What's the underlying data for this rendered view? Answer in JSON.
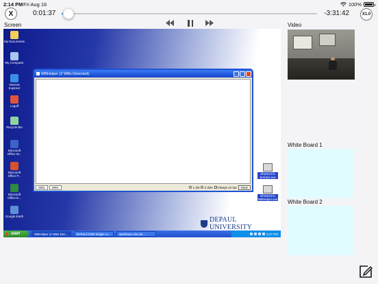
{
  "status_bar": {
    "time": "2:14 PM",
    "date": "Fri Aug 16",
    "battery": "100%",
    "battery_level": 1.0
  },
  "player": {
    "close_label": "X",
    "elapsed": "0:01:37",
    "remaining": "-3:31:42",
    "speed_label": "X1.0",
    "progress": 0.0045,
    "accent_color": "#0a7aff"
  },
  "controls": {
    "rewind_icon": "rewind-icon",
    "pause_icon": "pause-icon",
    "forward_icon": "fast-forward-icon"
  },
  "labels": {
    "screen": "Screen",
    "video": "Video",
    "white_board_1": "White Board 1",
    "white_board_2": "White Board 2"
  },
  "desktop": {
    "icons": [
      {
        "label": "My Documents",
        "color": "#f3cf5a"
      },
      {
        "label": "My Computer",
        "color": "#a9c7ee"
      },
      {
        "label": "Internet Explorer",
        "color": "#3b8ee8"
      },
      {
        "label": "Logoff",
        "color": "#e0543a"
      },
      {
        "label": "Recycle Bin",
        "color": "#8fd3a0"
      },
      {
        "label": "Microsoft Office W...",
        "color": "#3c62c8"
      },
      {
        "label": "Microsoft Office P...",
        "color": "#d8532d"
      },
      {
        "label": "Microsoft Office E...",
        "color": "#2e8a3e"
      },
      {
        "label": "Google Earth",
        "color": "#5d8fd6"
      }
    ],
    "right_icons": [
      {
        "label": "Shortcut to SnCam.exe"
      },
      {
        "label": "Shortcut to WBHelper.exe"
      }
    ],
    "window": {
      "title": "WBHelper (2 WBs Detected)",
      "tab1": "WB1",
      "tab2": "WB2",
      "opt1": "1 dot",
      "opt2": "2 dots",
      "opt3": "Always on top",
      "save": "Save"
    },
    "brand": "DEPAUL UNIVERSITY",
    "taskbar": {
      "start": "start",
      "items": [
        "WBHelper (2 WBs Det...",
        "DePaul CDM Single Lo...",
        "qwetknp1.xlsx.ds..."
      ],
      "clock": "5:47 PM"
    }
  }
}
